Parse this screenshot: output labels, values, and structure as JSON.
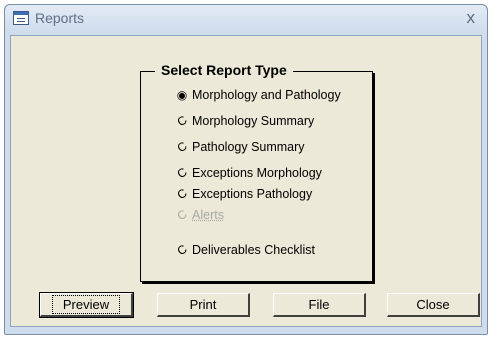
{
  "window": {
    "title": "Reports",
    "close_glyph": "x",
    "icon": "report-form-icon"
  },
  "group": {
    "title": "Select Report Type",
    "options": [
      {
        "label": "Morphology and Pathology",
        "selected": true,
        "enabled": true
      },
      {
        "label": "Morphology Summary",
        "selected": false,
        "enabled": true
      },
      {
        "label": "Pathology Summary",
        "selected": false,
        "enabled": true
      },
      {
        "label": "Exceptions Morphology",
        "selected": false,
        "enabled": true
      },
      {
        "label": "Exceptions Pathology",
        "selected": false,
        "enabled": true
      },
      {
        "label": "Alerts",
        "selected": false,
        "enabled": false
      },
      {
        "label": "Deliverables Checklist",
        "selected": false,
        "enabled": true
      }
    ]
  },
  "buttons": {
    "preview": "Preview",
    "print": "Print",
    "file": "File",
    "close": "Close"
  }
}
